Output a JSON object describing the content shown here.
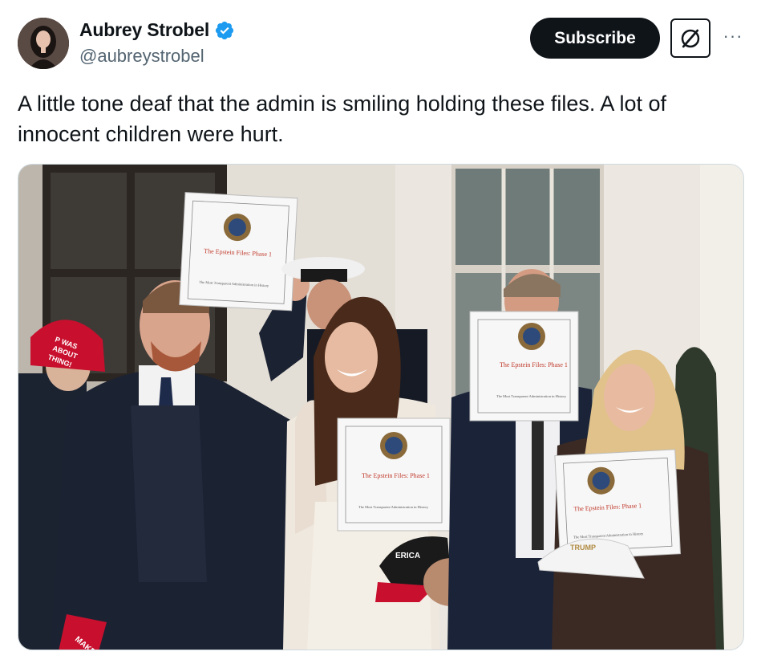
{
  "author": {
    "display_name": "Aubrey Strobel",
    "handle": "@aubreystrobel",
    "verified_icon": "verified-badge-icon",
    "verified_color": "#1d9bf0"
  },
  "actions": {
    "subscribe_label": "Subscribe",
    "grok_icon": "grok-icon",
    "more_icon": "more-icon",
    "more_glyph": "···"
  },
  "post": {
    "text": "A little tone deaf that the admin is smiling holding these files. A lot of innocent children were hurt."
  },
  "media": {
    "binders": [
      {
        "title": "The Epstein Files: Phase 1",
        "subtitle": "The Most Transparent Administration in History"
      },
      {
        "title": "The Epstein Files: Phase 1",
        "subtitle": "The Most Transparent Administration in History"
      },
      {
        "title": "The Epstein Files: Phase 1",
        "subtitle": "The Most Transparent Administration in History"
      },
      {
        "title": "The Epstein Files: Phase 1",
        "subtitle": "The Most Transparent Administration in History"
      }
    ],
    "hats": [
      {
        "text_line1": "P WAS",
        "text_line2": "ABOUT",
        "text_line3": "THING!"
      },
      {
        "text": "MAKE"
      },
      {
        "text": "ERICA"
      },
      {
        "text": "TRUMP"
      }
    ]
  },
  "colors": {
    "text_primary": "#0f1419",
    "text_secondary": "#536471",
    "button_dark": "#0f1419",
    "binder_red": "#c0392b",
    "hat_red": "#c8102e"
  }
}
